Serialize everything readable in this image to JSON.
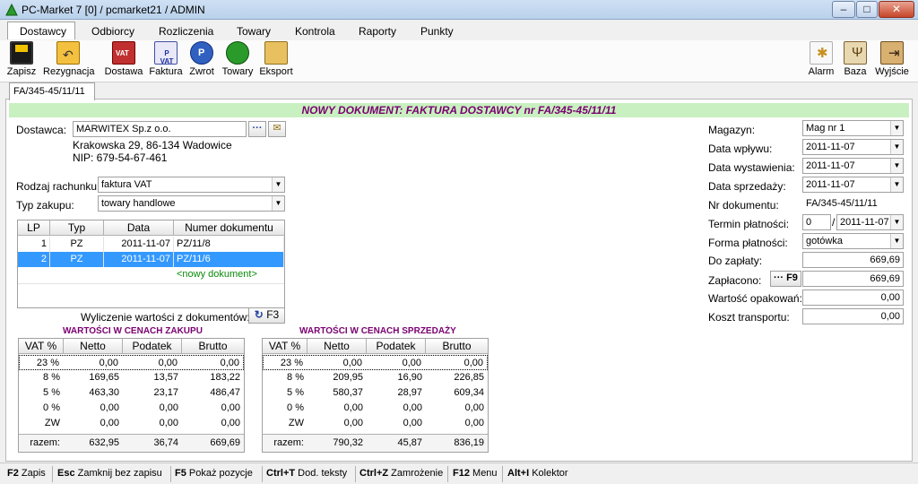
{
  "window": {
    "title": "PC-Market 7 [0] / pcmarket21 / ADMIN"
  },
  "menu": [
    "Dostawcy",
    "Odbiorcy",
    "Rozliczenia",
    "Towary",
    "Kontrola",
    "Raporty",
    "Punkty"
  ],
  "toolbar": {
    "left": [
      "Zapisz",
      "Rezygnacja",
      "Dostawa",
      "Faktura",
      "Zwrot",
      "Towary",
      "Eksport"
    ],
    "right": [
      "Alarm",
      "Baza",
      "Wyjście"
    ]
  },
  "doc_tab": "FA/345-45/11/11",
  "header": "NOWY DOKUMENT: FAKTURA DOSTAWCY nr FA/345-45/11/11",
  "supplier": {
    "label": "Dostawca:",
    "name": "MARWITEX Sp.z o.o.",
    "address": "Krakowska 29, 86-134 Wadowice",
    "nip": "NIP: 679-54-67-461",
    "browse_btn": "···"
  },
  "bill_type": {
    "label": "Rodzaj rachunku:",
    "value": "faktura VAT"
  },
  "purchase_type": {
    "label": "Typ zakupu:",
    "value": "towary handlowe"
  },
  "docs_table": {
    "headers": [
      "LP",
      "Typ",
      "Data",
      "Numer dokumentu"
    ],
    "rows": [
      {
        "lp": "1",
        "typ": "PZ",
        "data": "2011-11-07",
        "numer": "PZ/11/8"
      },
      {
        "lp": "2",
        "typ": "PZ",
        "data": "2011-11-07",
        "numer": "PZ/11/6"
      }
    ],
    "new_doc": "<nowy dokument>"
  },
  "calc": {
    "label": "Wyliczenie wartości z dokumentów:",
    "key": "F3"
  },
  "purchase_values": {
    "title": "WARTOŚCI W CENACH ZAKUPU",
    "headers": [
      "VAT %",
      "Netto",
      "Podatek",
      "Brutto"
    ],
    "rows": [
      [
        "23 %",
        "0,00",
        "0,00",
        "0,00"
      ],
      [
        "8 %",
        "169,65",
        "13,57",
        "183,22"
      ],
      [
        "5 %",
        "463,30",
        "23,17",
        "486,47"
      ],
      [
        "0 %",
        "0,00",
        "0,00",
        "0,00"
      ],
      [
        "ZW",
        "0,00",
        "0,00",
        "0,00"
      ]
    ],
    "total": [
      "razem:",
      "632,95",
      "36,74",
      "669,69"
    ]
  },
  "sale_values": {
    "title": "WARTOŚCI W CENACH SPRZEDAŻY",
    "headers": [
      "VAT %",
      "Netto",
      "Podatek",
      "Brutto"
    ],
    "rows": [
      [
        "23 %",
        "0,00",
        "0,00",
        "0,00"
      ],
      [
        "8 %",
        "209,95",
        "16,90",
        "226,85"
      ],
      [
        "5 %",
        "580,37",
        "28,97",
        "609,34"
      ],
      [
        "0 %",
        "0,00",
        "0,00",
        "0,00"
      ],
      [
        "ZW",
        "0,00",
        "0,00",
        "0,00"
      ]
    ],
    "total": [
      "razem:",
      "790,32",
      "45,87",
      "836,19"
    ]
  },
  "right_form": {
    "magazyn": {
      "label": "Magazyn:",
      "value": "Mag nr 1"
    },
    "data_wplywu": {
      "label": "Data wpływu:",
      "value": "2011-11-07"
    },
    "data_wystawienia": {
      "label": "Data wystawienia:",
      "value": "2011-11-07"
    },
    "data_sprzedazy": {
      "label": "Data sprzedaży:",
      "value": "2011-11-07"
    },
    "nr_dokumentu": {
      "label": "Nr dokumentu:",
      "value": "FA/345-45/11/11"
    },
    "termin": {
      "label": "Termin płatności:",
      "days": "0",
      "date": "2011-11-07"
    },
    "forma": {
      "label": "Forma płatności:",
      "value": "gotówka"
    },
    "do_zaplaty": {
      "label": "Do zapłaty:",
      "value": "669,69"
    },
    "zaplacono": {
      "label": "Zapłacono:",
      "btn": "··· F9",
      "value": "669,69"
    },
    "opakowan": {
      "label": "Wartość opakowań:",
      "value": "0,00"
    },
    "transport": {
      "label": "Koszt transportu:",
      "value": "0,00"
    }
  },
  "statusbar": [
    {
      "key": "F2",
      "text": "Zapis"
    },
    {
      "key": "Esc",
      "text": "Zamknij bez zapisu"
    },
    {
      "key": "F5",
      "text": "Pokaż pozycje"
    },
    {
      "key": "Ctrl+T",
      "text": "Dod. teksty"
    },
    {
      "key": "Ctrl+Z",
      "text": "Zamrożenie"
    },
    {
      "key": "F12",
      "text": "Menu"
    },
    {
      "key": "Alt+I",
      "text": "Kolektor"
    }
  ]
}
